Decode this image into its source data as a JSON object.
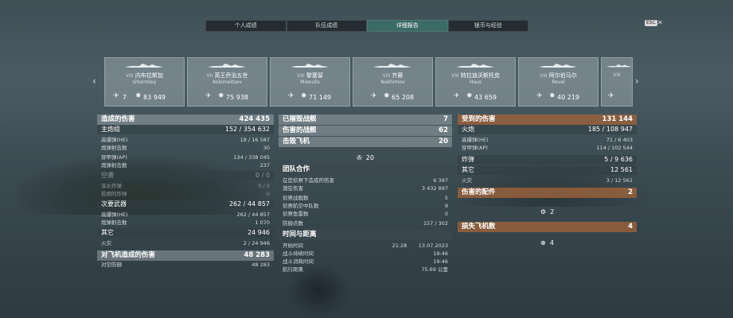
{
  "tabs": [
    "个人成绩",
    "队伍成绩",
    "详细报告",
    "银币与经验"
  ],
  "esc": "ESC",
  "close_glyph": "✕",
  "arrows": {
    "left": "‹",
    "right": "›"
  },
  "ships": [
    {
      "tier": "VIII",
      "name": "内布拉斯加",
      "original": "Ghormley",
      "kills": "7",
      "damage": "83 949"
    },
    {
      "tier": "VII",
      "name": "英王乔治五世",
      "original": "Kolomeitsev",
      "kills": "",
      "damage": "75 938"
    },
    {
      "tier": "VIII",
      "name": "黎塞留",
      "original": "Miaoulis",
      "kills": "",
      "damage": "71 149"
    },
    {
      "tier": "VIII",
      "name": "齐藤",
      "original": "Nakhimov",
      "kills": "",
      "damage": "65 208"
    },
    {
      "tier": "VIII",
      "name": "特拉迪沃斯托克",
      "original": "Haus",
      "kills": "",
      "damage": "43 659"
    },
    {
      "tier": "VIII",
      "name": "阿尔伯马尔",
      "original": "Revel",
      "kills": "",
      "damage": "40 219"
    },
    {
      "tier": "VIII",
      "name": "",
      "original": "",
      "kills": "",
      "damage": ""
    }
  ],
  "left": {
    "damage_caused": {
      "label": "造成的伤害",
      "value": "424 435"
    },
    "main_battery": {
      "label": "主炮组",
      "value": "152 / 354 632"
    },
    "he_label": "高爆弹(HE)",
    "he_value": "18 / 16 587",
    "he_hits_label": "炮弹射击数",
    "he_hits": "30",
    "ap_label": "穿甲弹(AP)",
    "ap_value": "134 / 338 045",
    "ap_hits_label": "炮弹射击数",
    "ap_hits": "237",
    "air": {
      "label": "空袭",
      "value": "0 / 0"
    },
    "depth_label": "深水炸弹",
    "depth_value": "0 / 0",
    "bomb_label": "投掷的炸弹",
    "bomb_value": "0",
    "secondary": {
      "label": "次要武器",
      "value": "262 / 44 857"
    },
    "sec_he_label": "高爆弹(HE)",
    "sec_he_value": "262 / 44 857",
    "sec_hits_label": "炮弹射击数",
    "sec_hits": "1 070",
    "other": {
      "label": "其它",
      "value": "24 946"
    },
    "fire_label": "火灾",
    "fire_value": "2 / 24 946",
    "aa": {
      "label": "对飞机造成的伤害",
      "value": "48 283"
    },
    "aa_def_label": "对空防御",
    "aa_def_value": "48 283"
  },
  "middle": {
    "destroyed": {
      "label": "已摧毁战舰",
      "value": "7"
    },
    "damaged": {
      "label": "伤害的战舰",
      "value": "62"
    },
    "planes": {
      "label": "击毁飞机",
      "value": "20"
    },
    "planes_icon_value": "20",
    "team": {
      "label": "团队合作"
    },
    "spot_dmg_label": "在您侦察下造成的伤害",
    "spot_dmg_value": "6 397",
    "potential_label": "潜在伤害",
    "potential_value": "3 432 897",
    "spot_ships_label": "侦察战舰数",
    "spot_ships_value": "5",
    "spot_planes_label": "侦察航空中队数",
    "spot_planes_value": "9",
    "spot_torp_label": "侦察鱼雷数",
    "spot_torp_value": "0",
    "defense_label": "防御点数",
    "defense_value": "157 / 302",
    "time": {
      "label": "时间与距离"
    },
    "start_label": "开始时间",
    "start_time": "21:28",
    "start_date": "13.07.2023",
    "duration_label": "战斗持续时间",
    "duration_value": "19:46",
    "consumed_label": "战斗消耗时间",
    "consumed_value": "19:46",
    "distance_label": "航行距离",
    "distance_value": "75.69 公里"
  },
  "right": {
    "received": {
      "label": "受到的伤害",
      "value": "131 144"
    },
    "main": {
      "label": "火炮",
      "value": "185 / 108 947"
    },
    "he_label": "高爆弹(HE)",
    "he_value": "71 / 6 403",
    "ap_label": "穿甲弹(AP)",
    "ap_value": "114 / 102 544",
    "bombs": {
      "label": "炸弹",
      "value": "5 / 9 636"
    },
    "other": {
      "label": "其它",
      "value": "12 561"
    },
    "fire_label": "火灾",
    "fire_value": "3 / 12 561",
    "modules": {
      "label": "伤害的配件",
      "value": "2"
    },
    "modules_icon_value": "2",
    "lost_planes": {
      "label": "损失飞机数",
      "value": "4"
    },
    "lost_icon_value": "4"
  }
}
